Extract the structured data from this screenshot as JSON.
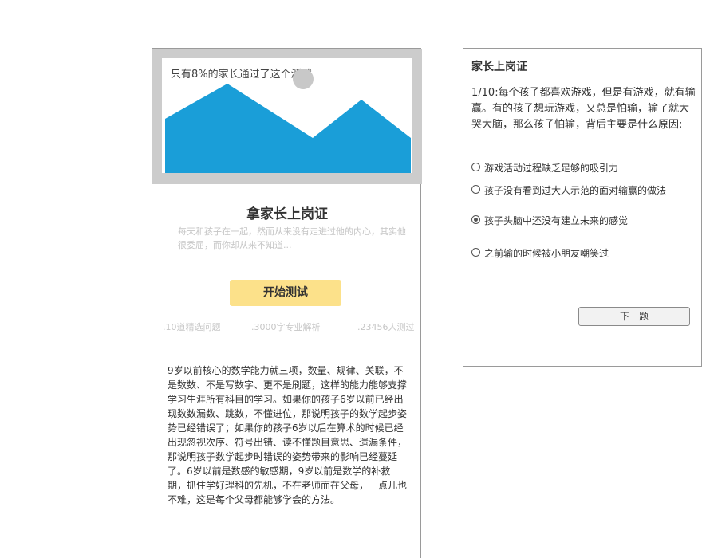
{
  "landing": {
    "hero_caption": "只有8%的家长通过了这个测试",
    "title": "拿家长上岗证",
    "description": "每天和孩子在一起，然而从来没有走进过他的内心，其实他很委屈，而你却从来不知道...",
    "start_button": "开始测试",
    "features": [
      ".10道精选问题",
      ".3000字专业解析",
      ".23456人测过"
    ],
    "intro": "9岁以前核心的数学能力就三项，数量、规律、关联，不是数数、不是写数字、更不是刷题，这样的能力能够支撑学习生涯所有科目的学习。如果你的孩子6岁以前已经出现数数漏数、跳数，不懂进位，那说明孩子的数学起步姿势已经错误了；如果你的孩子6岁以后在算术的时候已经出现忽视次序、符号出错、读不懂题目意思、遗漏条件，那说明孩子数学起步时错误的姿势带来的影响已经蔓延了。6岁以前是数感的敏感期，9岁以前是数学的补救期，抓住学好理科的先机，不在老师而在父母，一点儿也不难，这是每个父母都能够学会的方法。",
    "hero_color": "#1a9ed8"
  },
  "quiz": {
    "title": "家长上岗证",
    "question": "1/10:每个孩子都喜欢游戏，但是有游戏，就有输赢。有的孩子想玩游戏，又总是怕输，输了就大哭大脑，那么孩子怕输，背后主要是什么原因:",
    "options": [
      {
        "label": "游戏活动过程缺乏足够的吸引力",
        "selected": false
      },
      {
        "label": "孩子没有看到过大人示范的面对输赢的做法",
        "selected": false
      },
      {
        "label": "孩子头脑中还没有建立未来的感觉",
        "selected": true
      },
      {
        "label": "之前输的时候被小朋友嘲笑过",
        "selected": false
      }
    ],
    "next_button": "下一题"
  }
}
